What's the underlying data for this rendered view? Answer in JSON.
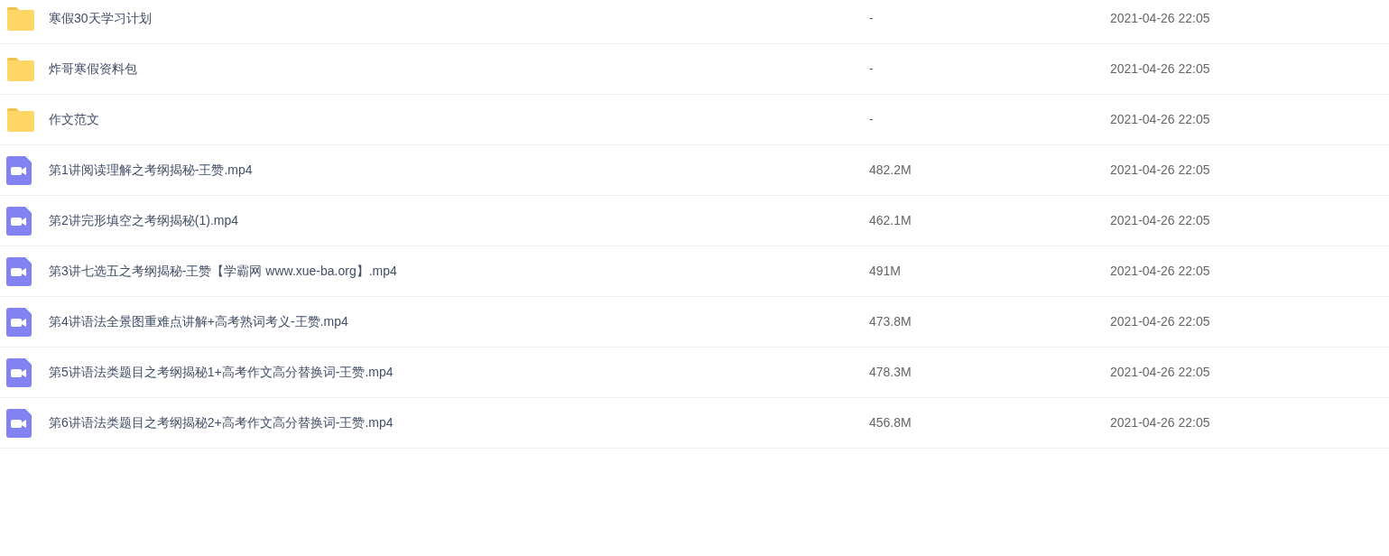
{
  "files": [
    {
      "kind": "folder",
      "name": "寒假30天学习计划",
      "size": "-",
      "modified": "2021-04-26 22:05"
    },
    {
      "kind": "folder",
      "name": "炸哥寒假资料包",
      "size": "-",
      "modified": "2021-04-26 22:05"
    },
    {
      "kind": "folder",
      "name": "作文范文",
      "size": "-",
      "modified": "2021-04-26 22:05"
    },
    {
      "kind": "video",
      "name": "第1讲阅读理解之考纲揭秘-王赞.mp4",
      "size": "482.2M",
      "modified": "2021-04-26 22:05"
    },
    {
      "kind": "video",
      "name": "第2讲完形填空之考纲揭秘(1).mp4",
      "size": "462.1M",
      "modified": "2021-04-26 22:05"
    },
    {
      "kind": "video",
      "name": "第3讲七选五之考纲揭秘-王赞【学霸网 www.xue-ba.org】.mp4",
      "size": "491M",
      "modified": "2021-04-26 22:05"
    },
    {
      "kind": "video",
      "name": "第4讲语法全景图重难点讲解+高考熟词考义-王赞.mp4",
      "size": "473.8M",
      "modified": "2021-04-26 22:05"
    },
    {
      "kind": "video",
      "name": "第5讲语法类题目之考纲揭秘1+高考作文高分替换词-王赞.mp4",
      "size": "478.3M",
      "modified": "2021-04-26 22:05"
    },
    {
      "kind": "video",
      "name": "第6讲语法类题目之考纲揭秘2+高考作文高分替换词-王赞.mp4",
      "size": "456.8M",
      "modified": "2021-04-26 22:05"
    }
  ]
}
